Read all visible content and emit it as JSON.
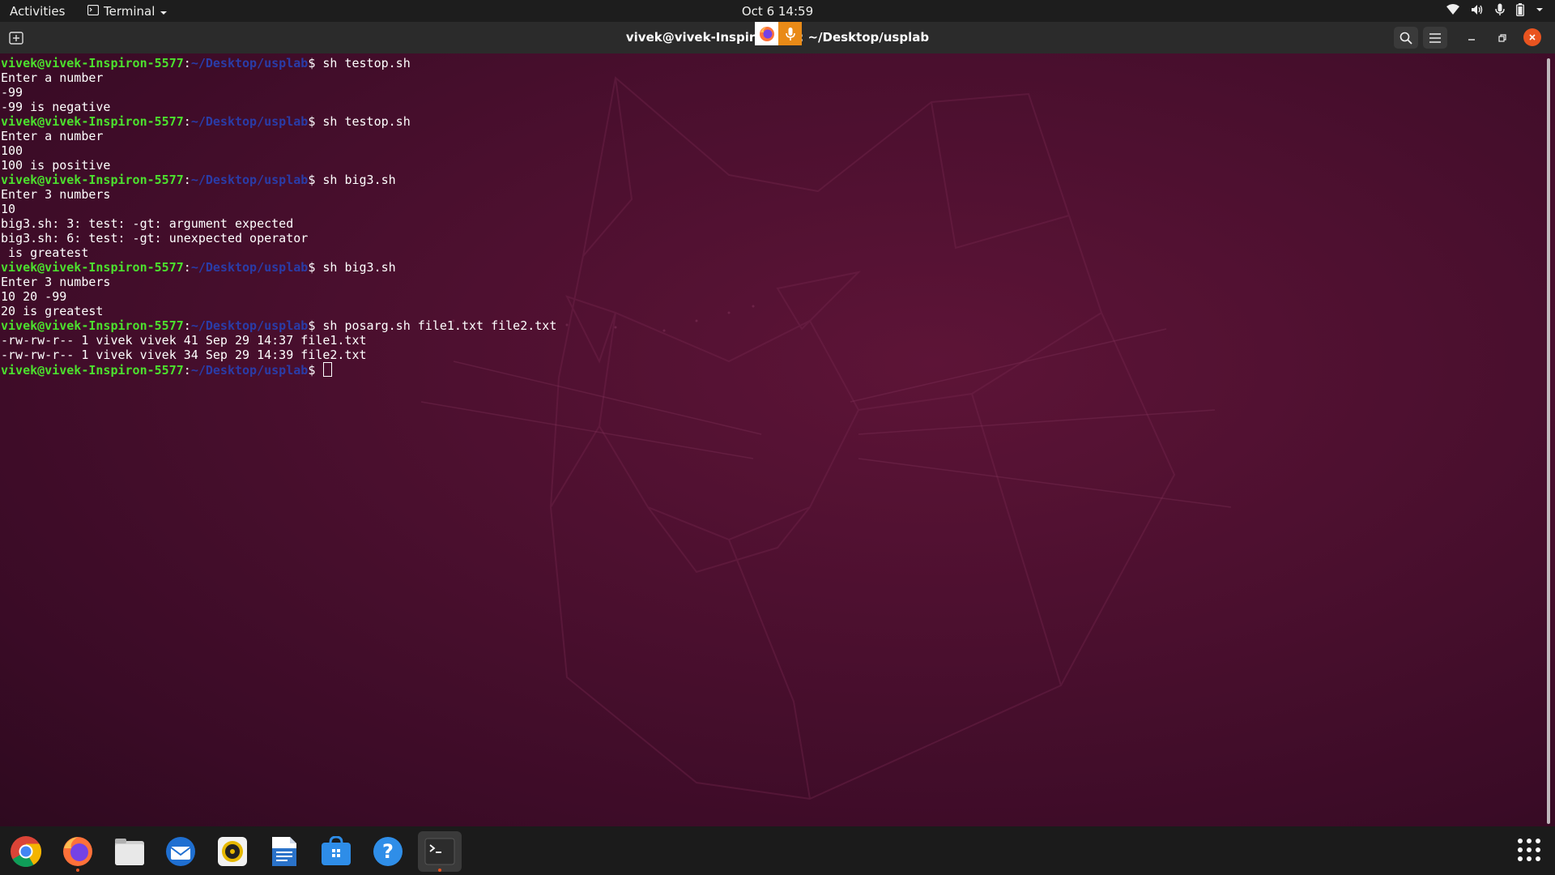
{
  "topbar": {
    "activities": "Activities",
    "app_name": "Terminal",
    "datetime": "Oct 6  14:59",
    "tray_icons": [
      "wifi-icon",
      "volume-icon",
      "microphone-icon",
      "battery-icon",
      "chevron-down-icon"
    ]
  },
  "window": {
    "title_part1": "vivek@vivek-Inspir",
    "title_part2": ": ~/Desktop/usplab"
  },
  "terminal": {
    "lines": [
      {
        "type": "prompt",
        "user": "vivek@vivek-Inspiron-5577",
        "path": "~/Desktop/usplab",
        "cmd": "sh testop.sh"
      },
      {
        "type": "output",
        "text": "Enter a number"
      },
      {
        "type": "output",
        "text": "-99"
      },
      {
        "type": "output",
        "text": "-99 is negative"
      },
      {
        "type": "prompt",
        "user": "vivek@vivek-Inspiron-5577",
        "path": "~/Desktop/usplab",
        "cmd": "sh testop.sh"
      },
      {
        "type": "output",
        "text": "Enter a number"
      },
      {
        "type": "output",
        "text": "100"
      },
      {
        "type": "output",
        "text": "100 is positive"
      },
      {
        "type": "prompt",
        "user": "vivek@vivek-Inspiron-5577",
        "path": "~/Desktop/usplab",
        "cmd": "sh big3.sh"
      },
      {
        "type": "output",
        "text": "Enter 3 numbers"
      },
      {
        "type": "output",
        "text": "10"
      },
      {
        "type": "output",
        "text": "big3.sh: 3: test: -gt: argument expected"
      },
      {
        "type": "output",
        "text": "big3.sh: 6: test: -gt: unexpected operator"
      },
      {
        "type": "output",
        "text": " is greatest"
      },
      {
        "type": "prompt",
        "user": "vivek@vivek-Inspiron-5577",
        "path": "~/Desktop/usplab",
        "cmd": "sh big3.sh"
      },
      {
        "type": "output",
        "text": "Enter 3 numbers"
      },
      {
        "type": "output",
        "text": "10 20 -99"
      },
      {
        "type": "output",
        "text": "20 is greatest"
      },
      {
        "type": "prompt",
        "user": "vivek@vivek-Inspiron-5577",
        "path": "~/Desktop/usplab",
        "cmd": "sh posarg.sh file1.txt file2.txt"
      },
      {
        "type": "output",
        "text": "-rw-rw-r-- 1 vivek vivek 41 Sep 29 14:37 file1.txt"
      },
      {
        "type": "output",
        "text": "-rw-rw-r-- 1 vivek vivek 34 Sep 29 14:39 file2.txt"
      },
      {
        "type": "prompt",
        "user": "vivek@vivek-Inspiron-5577",
        "path": "~/Desktop/usplab",
        "cmd": "",
        "cursor": true
      }
    ]
  },
  "dock": {
    "items": [
      {
        "name": "chrome-icon",
        "active": false
      },
      {
        "name": "firefox-icon",
        "active": false,
        "running": true
      },
      {
        "name": "files-icon",
        "active": false
      },
      {
        "name": "thunderbird-icon",
        "active": false
      },
      {
        "name": "rhythmbox-icon",
        "active": false
      },
      {
        "name": "libreoffice-writer-icon",
        "active": false
      },
      {
        "name": "software-store-icon",
        "active": false
      },
      {
        "name": "help-icon",
        "active": false
      },
      {
        "name": "terminal-icon",
        "active": true,
        "running": true
      }
    ],
    "show_apps": "show-applications-icon"
  },
  "colors": {
    "prompt_user": "#4ce02e",
    "prompt_path": "#2a3ca8",
    "accent": "#e95420"
  }
}
